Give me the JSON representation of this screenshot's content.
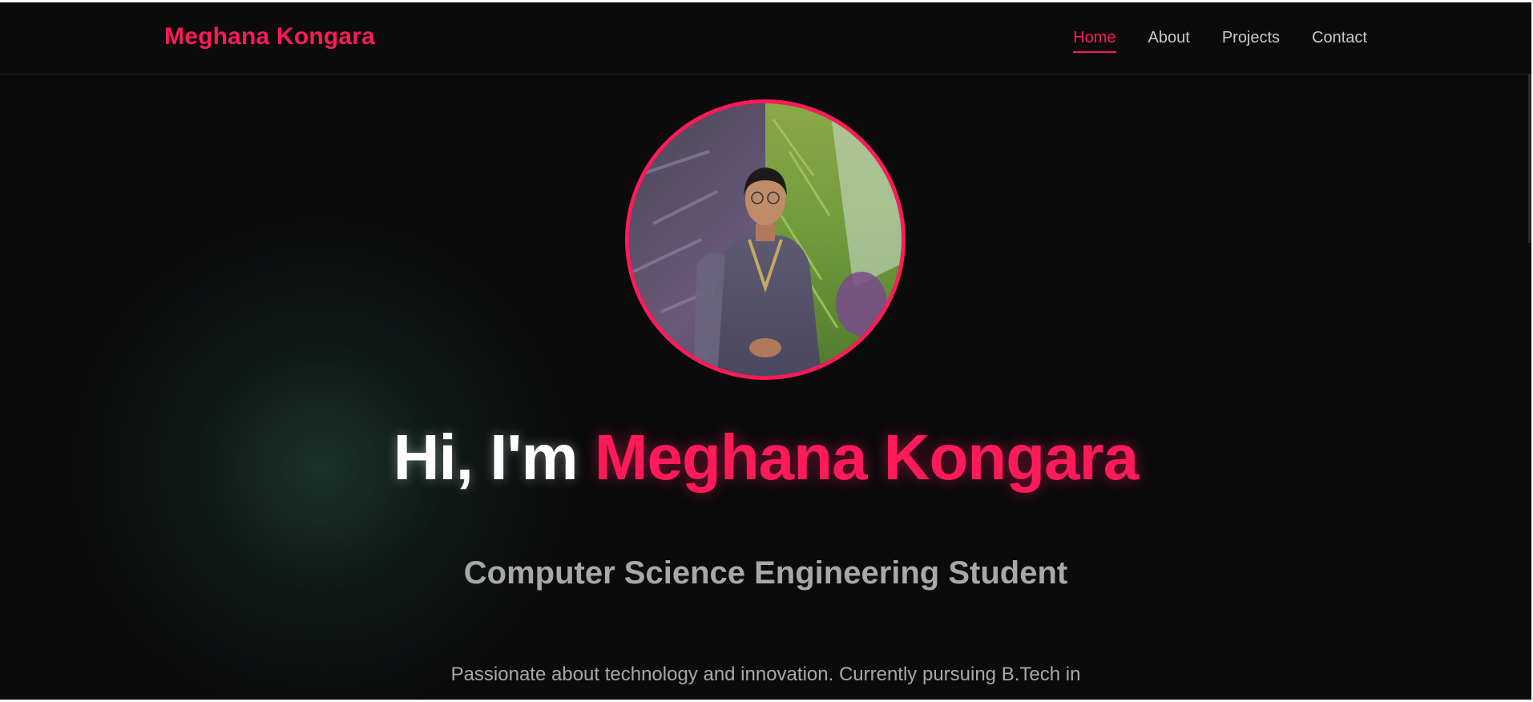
{
  "theme": {
    "accent": "#ff1a5a",
    "background": "#0b0b0c",
    "text_muted": "#a8a8a8",
    "text_light": "#ffffff"
  },
  "navbar": {
    "brand": "Meghana Kongara",
    "links": [
      {
        "label": "Home",
        "active": true
      },
      {
        "label": "About",
        "active": false
      },
      {
        "label": "Projects",
        "active": false
      },
      {
        "label": "Contact",
        "active": false
      }
    ]
  },
  "hero": {
    "greeting": "Hi, I'm",
    "name": "Meghana Kongara",
    "subtitle": "Computer Science Engineering Student",
    "description": "Passionate about technology and innovation. Currently pursuing B.Tech in"
  }
}
